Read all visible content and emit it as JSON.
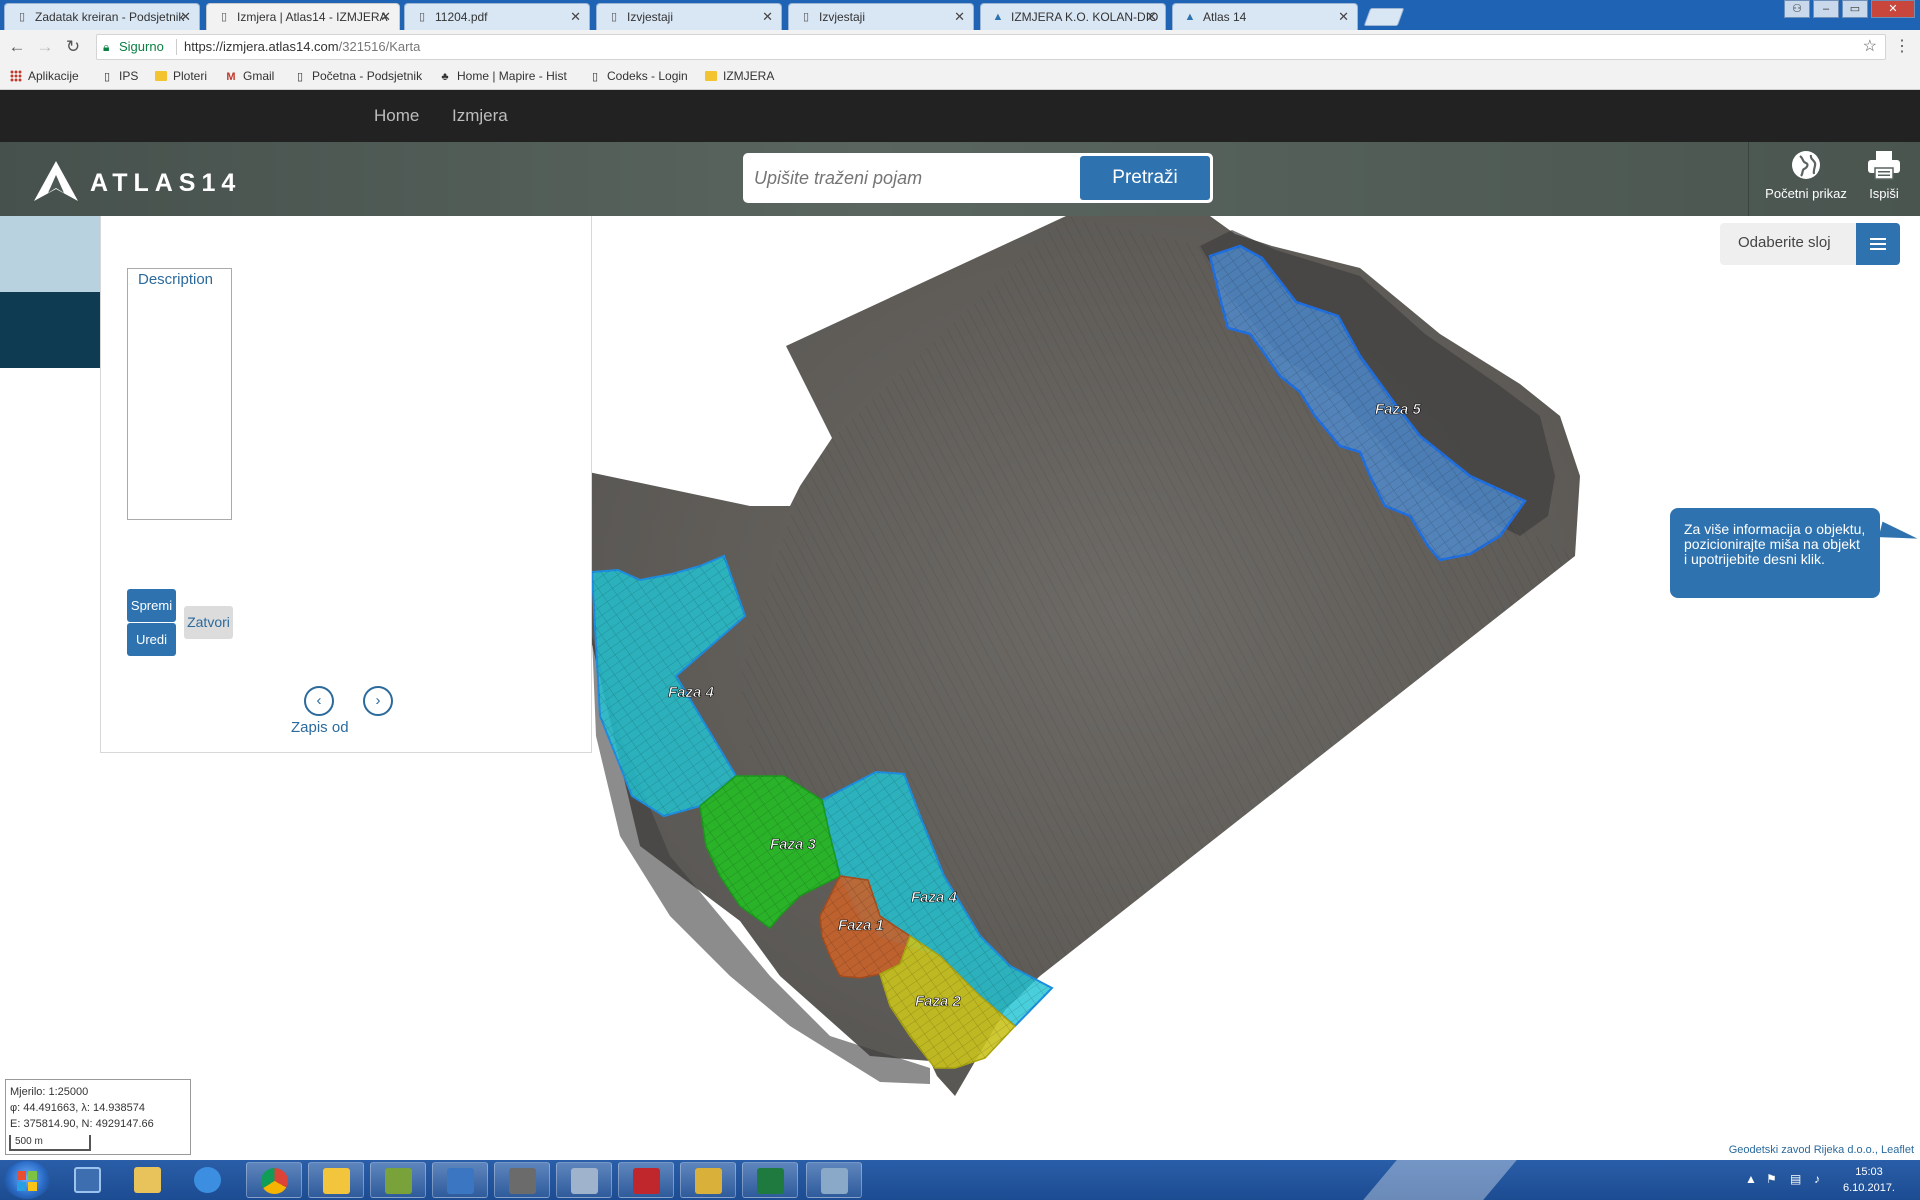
{
  "browser": {
    "tabs": [
      {
        "title": "Zadatak kreiran - Podsjetnik",
        "icon": "doc-icon",
        "active": false
      },
      {
        "title": "Izmjera | Atlas14 - IZMJERA",
        "icon": "doc-icon",
        "active": true
      },
      {
        "title": "11204.pdf",
        "icon": "doc-icon",
        "active": false
      },
      {
        "title": "Izvjestaji",
        "icon": "doc-icon",
        "active": false
      },
      {
        "title": "Izvjestaji",
        "icon": "doc-icon",
        "active": false
      },
      {
        "title": "IZMJERA K.O. KOLAN-DIO",
        "icon": "atlas-icon",
        "active": false
      },
      {
        "title": "Atlas 14",
        "icon": "atlas-icon",
        "active": false
      }
    ],
    "secure_label": "Sigurno",
    "url_host": "https://izmjera.atlas14.com",
    "url_path": "/321516/Karta",
    "bookmarks": [
      {
        "label": "Aplikacije",
        "icon": "apps-grid-icon"
      },
      {
        "label": "IPS",
        "icon": "page-icon"
      },
      {
        "label": "Ploteri",
        "icon": "folder-icon"
      },
      {
        "label": "Gmail",
        "icon": "gmail-icon"
      },
      {
        "label": "Početna - Podsjetnik",
        "icon": "page-icon"
      },
      {
        "label": "Home | Mapire - Hist",
        "icon": "mapire-icon"
      },
      {
        "label": "Codeks - Login",
        "icon": "page-icon"
      },
      {
        "label": "IZMJERA",
        "icon": "folder-icon"
      }
    ]
  },
  "site": {
    "nav": [
      {
        "label": "Home"
      },
      {
        "label": "Izmjera"
      }
    ],
    "logo_text": "ATLAS14",
    "search_placeholder": "Upišite traženi pojam",
    "search_button": "Pretraži",
    "tools": [
      {
        "label": "Početni prikaz",
        "icon": "globe-icon"
      },
      {
        "label": "Ispiši",
        "icon": "printer-icon"
      }
    ]
  },
  "panel": {
    "description_label": "Description",
    "save_button": "Spremi",
    "edit_button": "Uredi",
    "close_button": "Zatvori",
    "prev_icon": "chevron-left-icon",
    "next_icon": "chevron-right-icon",
    "record_label": "Zapis od"
  },
  "map": {
    "layer_selector_label": "Odaberite sloj",
    "tooltip": "Za više informacija o objektu, pozicionirajte miša na objekt i upotrijebite desni klik.",
    "phases": [
      {
        "label": "Faza 1",
        "color": "#c8622a"
      },
      {
        "label": "Faza 2",
        "color": "#c9c21d"
      },
      {
        "label": "Faza 3",
        "color": "#25bb25"
      },
      {
        "label": "Faza 4",
        "color": "#21c5d3"
      },
      {
        "label": "Faza 4",
        "color": "#21c5d3"
      },
      {
        "label": "Faza 5",
        "color": "#4d8fd8"
      }
    ],
    "scale_line": "Mjerilo: 1:25000",
    "geo_line": "φ: 44.491663, λ: 14.938574",
    "proj_line": "E: 375814.90, N: 4929147.66",
    "scalebar_label": "500 m",
    "attribution": "Geodetski zavod Rijeka d.o.o., Leaflet"
  },
  "taskbar": {
    "time": "15:03",
    "date": "6.10.2017."
  }
}
